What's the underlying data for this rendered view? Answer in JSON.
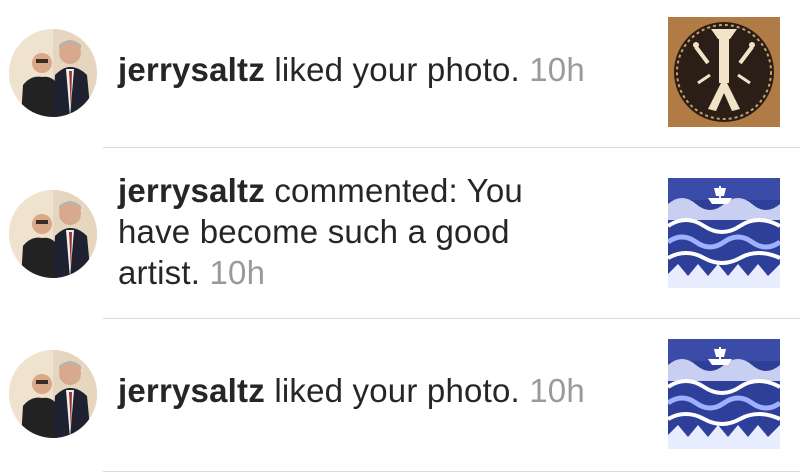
{
  "notifications": [
    {
      "username": "jerrysaltz",
      "action": "liked your photo.",
      "time": "10h",
      "thumbnail_icon": "tribal-figure-artwork"
    },
    {
      "username": "jerrysaltz",
      "action": "commented: You have become such a good artist.",
      "time": "10h",
      "thumbnail_icon": "ship-on-waves-artwork"
    },
    {
      "username": "jerrysaltz",
      "action": "liked your photo.",
      "time": "10h",
      "thumbnail_icon": "ship-on-waves-artwork"
    }
  ],
  "colors": {
    "text": "#262626",
    "timestamp": "#9a9a9a",
    "divider": "#dbdbdb"
  }
}
